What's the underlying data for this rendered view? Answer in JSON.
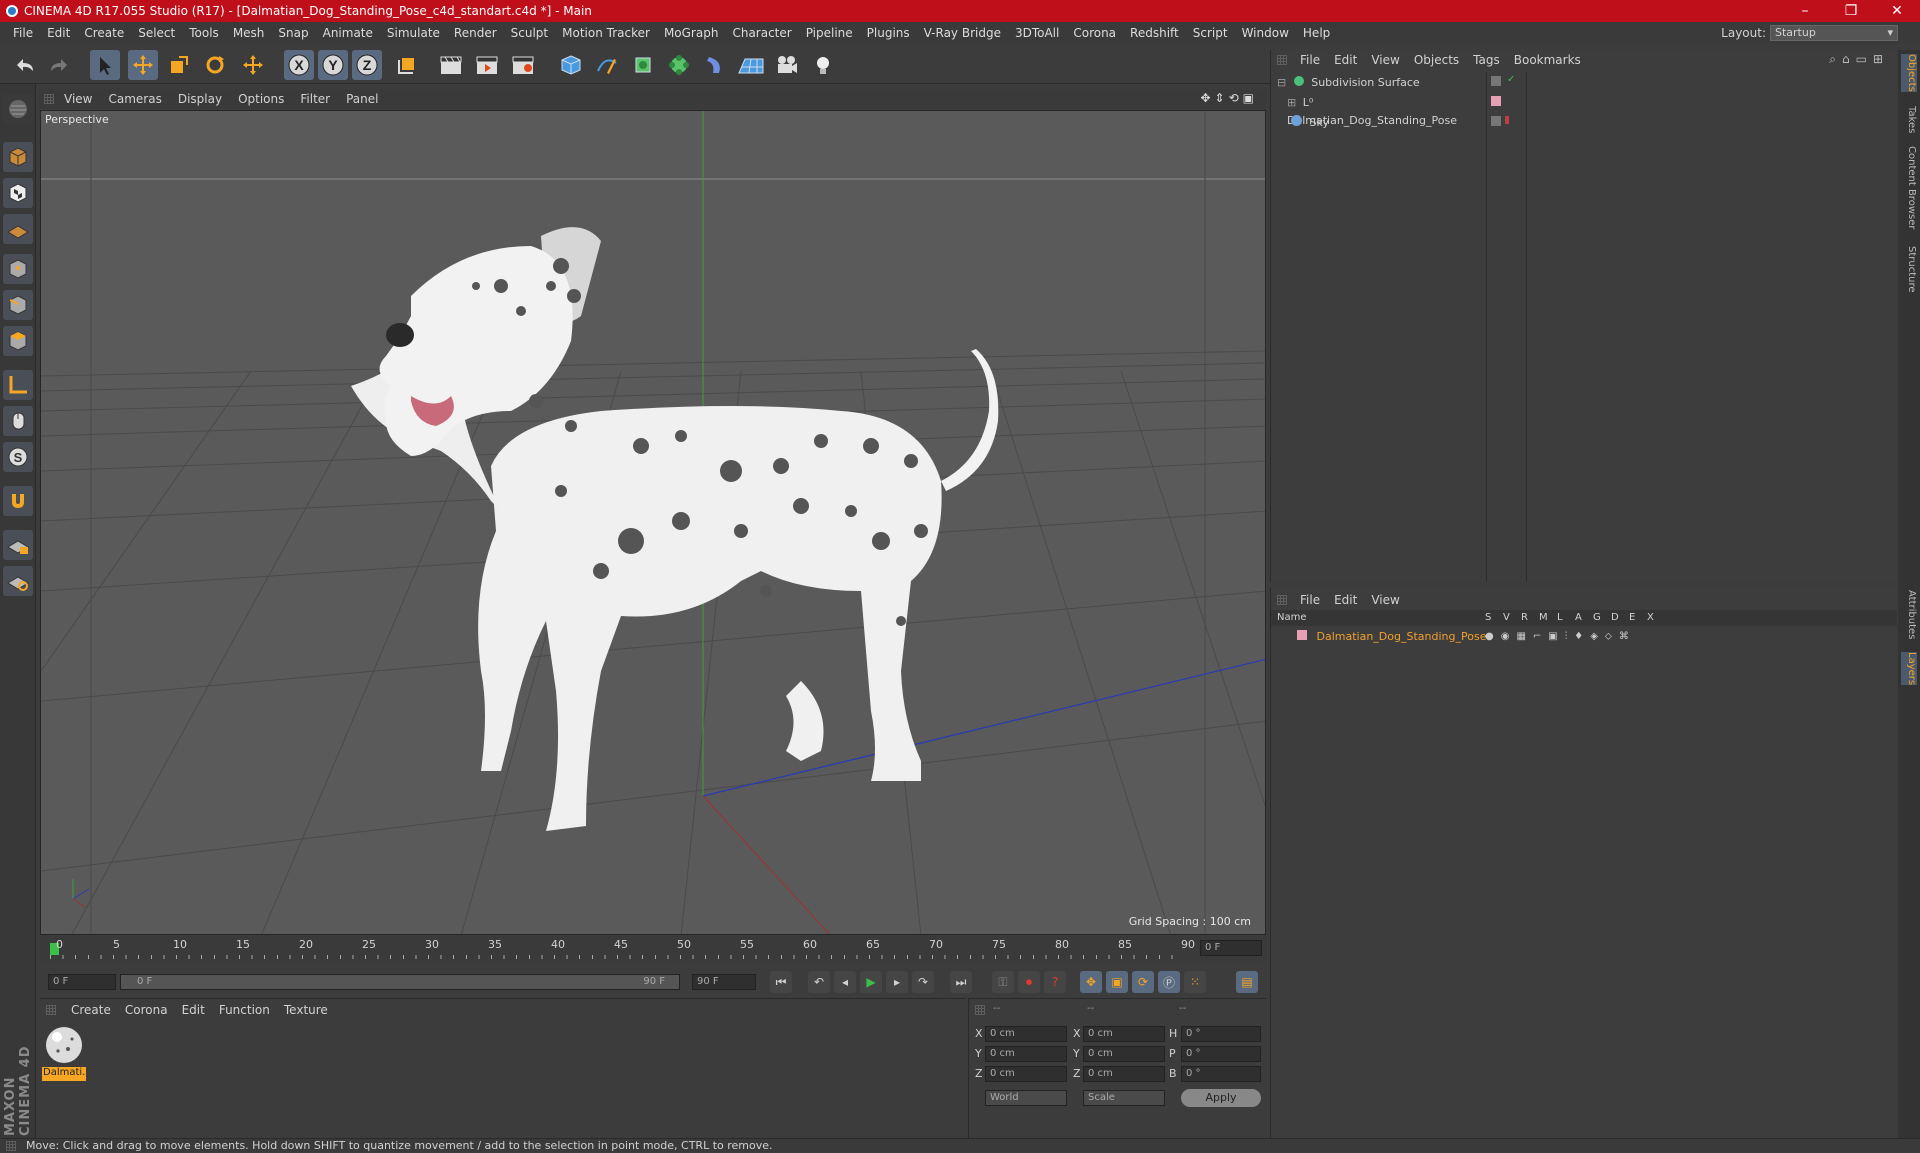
{
  "window": {
    "title": "CINEMA 4D R17.055 Studio (R17) - [Dalmatian_Dog_Standing_Pose_c4d_standart.c4d *] - Main",
    "minimize": "–",
    "restore": "❐",
    "close": "✕"
  },
  "menu": [
    "File",
    "Edit",
    "Create",
    "Select",
    "Tools",
    "Mesh",
    "Snap",
    "Animate",
    "Simulate",
    "Render",
    "Sculpt",
    "Motion Tracker",
    "MoGraph",
    "Character",
    "Pipeline",
    "Plugins",
    "V-Ray Bridge",
    "3DToAll",
    "Corona",
    "Redshift",
    "Script",
    "Window",
    "Help"
  ],
  "layout": {
    "label": "Layout:",
    "value": "Startup"
  },
  "viewport": {
    "menu": [
      "View",
      "Cameras",
      "Display",
      "Options",
      "Filter",
      "Panel"
    ],
    "camera_label": "Perspective",
    "grid_spacing": "Grid Spacing : 100 cm"
  },
  "timeline": {
    "ticks": [
      "0",
      "5",
      "10",
      "15",
      "20",
      "25",
      "30",
      "35",
      "40",
      "45",
      "50",
      "55",
      "60",
      "65",
      "70",
      "75",
      "80",
      "85",
      "90"
    ],
    "current_frame_field": "0 F",
    "start_field": "0 F",
    "range_start": "0 F",
    "range_end": "90 F",
    "end_field": "90 F"
  },
  "material_panel": {
    "menu": [
      "Create",
      "Corona",
      "Edit",
      "Function",
      "Texture"
    ],
    "material_name": "Dalmati..."
  },
  "brand": "MAXON CINEMA 4D",
  "coords": {
    "header": [
      "--",
      "--",
      "--"
    ],
    "rows": [
      {
        "a": "X",
        "av": "0 cm",
        "b": "X",
        "bv": "0 cm",
        "c": "H",
        "cv": "0 °"
      },
      {
        "a": "Y",
        "av": "0 cm",
        "b": "Y",
        "bv": "0 cm",
        "c": "P",
        "cv": "0 °"
      },
      {
        "a": "Z",
        "av": "0 cm",
        "b": "Z",
        "bv": "0 cm",
        "c": "B",
        "cv": "0 °"
      }
    ],
    "world": "World",
    "scale": "Scale",
    "apply": "Apply"
  },
  "objects_panel": {
    "menu": [
      "File",
      "Edit",
      "View",
      "Objects",
      "Tags",
      "Bookmarks"
    ],
    "items": [
      {
        "name": "Subdivision Surface"
      },
      {
        "name": "Dalmatian_Dog_Standing_Pose"
      },
      {
        "name": "Sky"
      }
    ]
  },
  "layers_panel": {
    "menu": [
      "File",
      "Edit",
      "View"
    ],
    "columns": [
      "Name",
      "S",
      "V",
      "R",
      "M",
      "L",
      "A",
      "G",
      "D",
      "E",
      "X"
    ],
    "layer_name": "Dalmatian_Dog_Standing_Pose"
  },
  "side_tabs": [
    "Objects",
    "Takes",
    "Content Browser",
    "Structure",
    "Attributes",
    "Layers"
  ],
  "status": "Move: Click and drag to move elements. Hold down SHIFT to quantize movement / add to the selection in point mode, CTRL to remove.",
  "colors": {
    "title_bar": "#bf0f1a",
    "accent_orange": "#f5a623",
    "selected_blue": "#5a6a80",
    "layer_name": "#f0a030"
  }
}
